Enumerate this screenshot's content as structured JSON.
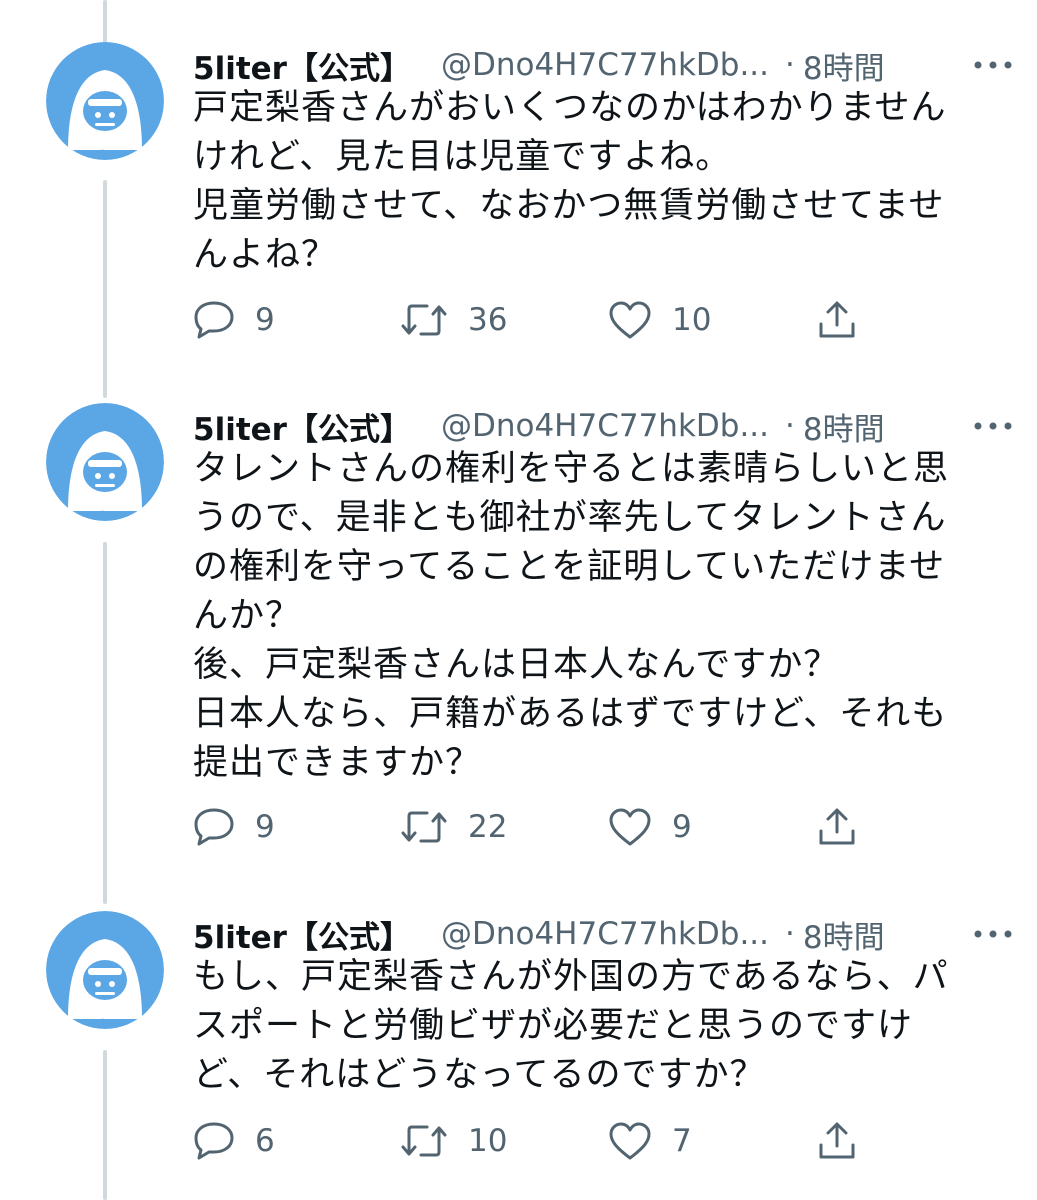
{
  "tweets": [
    {
      "name": "5liter【公式】",
      "handle": "@Dno4H7C77hkDb...",
      "dot": "·",
      "time": "8時間",
      "avatar_label": "5liter",
      "lines": [
        "戸定梨香さんがおいくつなのかはわかりません",
        "けれど、見た目は児童ですよね。",
        "児童労働させて、なおかつ無賃労働させてませ",
        "んよね？"
      ],
      "replies": "9",
      "retweets": "36",
      "likes": "10"
    },
    {
      "name": "5liter【公式】",
      "handle": "@Dno4H7C77hkDb...",
      "dot": "·",
      "time": "8時間",
      "avatar_label": "5liter",
      "lines": [
        "タレントさんの権利を守るとは素晴らしいと思",
        "うので、是非とも御社が率先してタレントさん",
        "の権利を守ってることを証明していただけませ",
        "んか？",
        "後、戸定梨香さんは日本人なんですか？",
        "日本人なら、戸籍があるはずですけど、それも",
        "提出できますか？"
      ],
      "replies": "9",
      "retweets": "22",
      "likes": "9"
    },
    {
      "name": "5liter【公式】",
      "handle": "@Dno4H7C77hkDb...",
      "dot": "·",
      "time": "8時間",
      "avatar_label": "5liter",
      "lines": [
        "もし、戸定梨香さんが外国の方であるなら、パ",
        "スポートと労働ビザが必要だと思うのですけ",
        "ど、それはどうなってるのですか？"
      ],
      "replies": "6",
      "retweets": "10",
      "likes": "7"
    }
  ],
  "colors": {
    "avatar_bg": "#5ba7e6",
    "text": "#0f1419",
    "muted": "#536471",
    "thread_line": "#cfd9de"
  },
  "icons": {
    "avatar": "gorilla-icon",
    "more": "more-icon",
    "reply": "reply-icon",
    "retweet": "retweet-icon",
    "like": "heart-icon",
    "share": "share-icon"
  }
}
